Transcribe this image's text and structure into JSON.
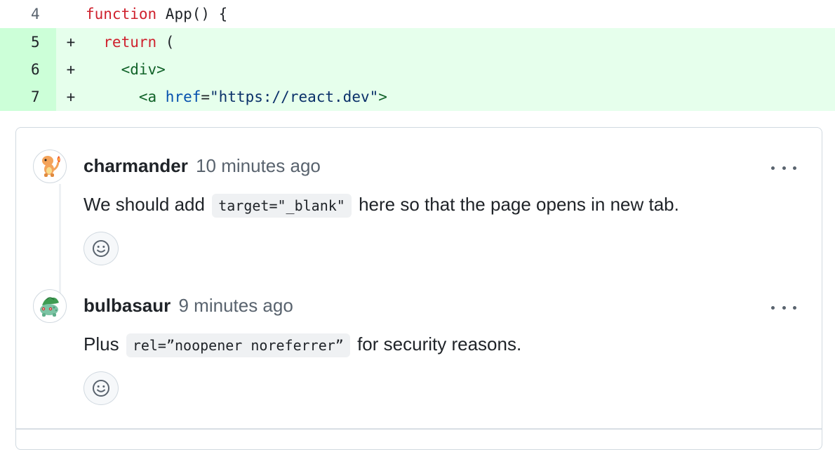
{
  "code_lines": [
    {
      "number": "4",
      "marker": "",
      "tokens": [
        "function",
        " App() {"
      ]
    },
    {
      "number": "5",
      "marker": "+",
      "tokens": [
        "  return",
        " ("
      ]
    },
    {
      "number": "6",
      "marker": "+",
      "tokens": [
        "    <div>"
      ]
    },
    {
      "number": "7",
      "marker": "+",
      "tokens": [
        "      <a",
        " href",
        "=",
        "\"https://react.dev\"",
        ">"
      ]
    }
  ],
  "comments": [
    {
      "author": "charmander",
      "time": "10 minutes ago",
      "text_before": "We should add",
      "code": "target=\"_blank\"",
      "text_after": "here so that the page opens in new tab.",
      "avatar_icon": "charmander-avatar"
    },
    {
      "author": "bulbasaur",
      "time": "9 minutes ago",
      "text_before": "Plus",
      "code": "rel=”noopener noreferrer”",
      "text_after": "for security reasons.",
      "avatar_icon": "bulbasaur-avatar"
    }
  ],
  "colors": {
    "added_bg": "#e6ffec",
    "added_num_bg": "#ccffd8",
    "keyword": "#cf222e",
    "tag": "#116329",
    "attr": "#0550ae",
    "string": "#0a3069"
  }
}
